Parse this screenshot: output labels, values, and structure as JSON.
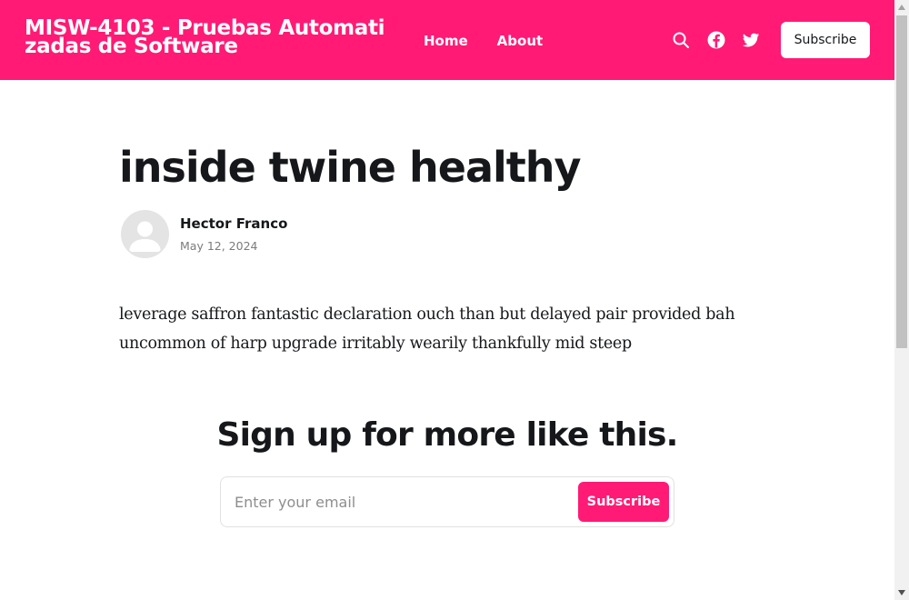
{
  "header": {
    "site_title": "MISW-4103 - Pruebas Automati\nzadas de Software",
    "nav": [
      {
        "label": "Home"
      },
      {
        "label": "About"
      }
    ],
    "icons": {
      "search": "search-icon",
      "facebook": "facebook-icon",
      "twitter": "twitter-icon"
    },
    "subscribe_label": "Subscribe",
    "brand_color": "#ff1a75"
  },
  "post": {
    "title": "inside twine healthy",
    "author": "Hector Franco",
    "date": "May 12, 2024",
    "body": "leverage saffron fantastic declaration ouch than but delayed pair provided bah uncommon of harp upgrade irritably wearily thankfully mid steep"
  },
  "cta": {
    "title": "Sign up for more like this.",
    "email_placeholder": "Enter your email",
    "button_label": "Subscribe"
  }
}
